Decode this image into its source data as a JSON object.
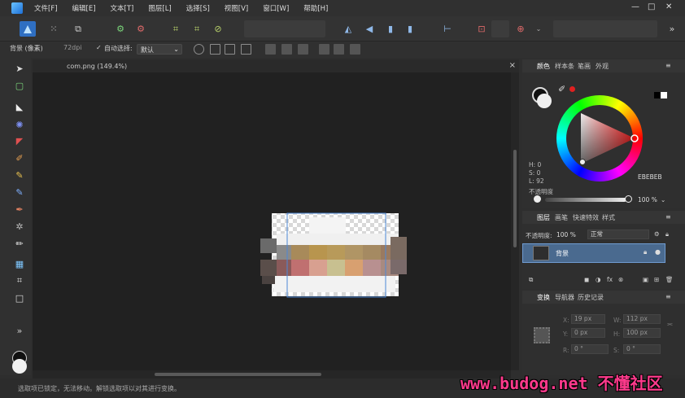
{
  "menu": {
    "items": [
      "文件[F]",
      "编辑[E]",
      "文本[T]",
      "图层[L]",
      "选择[S]",
      "视图[V]",
      "窗口[W]",
      "帮助[H]"
    ],
    "window_controls": [
      "—",
      "□",
      "✕"
    ]
  },
  "context": {
    "layer_label": "背景 (像素)",
    "dpi": "72dpi",
    "auto_select_label": "自动选择:",
    "auto_select_value": "默认"
  },
  "document": {
    "tab_title": "com.png (149.4%)"
  },
  "status": {
    "text": "选取项已锁定，无法移动。解锁选取项以对其进行变换。"
  },
  "color_panel": {
    "tabs": [
      "颜色",
      "样本条",
      "笔画",
      "外观"
    ],
    "h": "H: 0",
    "s": "S: 0",
    "l": "L: 92",
    "hex": "EBEBEB",
    "opacity_label": "不透明度",
    "opacity_value": "100 %"
  },
  "layers_panel": {
    "tabs": [
      "图层",
      "画笔",
      "快速特效",
      "样式"
    ],
    "opacity_label": "不透明度:",
    "opacity_value": "100 %",
    "blend_mode": "正常",
    "layer_name": "背景"
  },
  "transform_panel": {
    "tabs": [
      "变换",
      "导航器",
      "历史记录"
    ],
    "x_label": "X:",
    "x_value": "19 px",
    "y_label": "Y:",
    "y_value": "0 px",
    "w_label": "W:",
    "w_value": "112 px",
    "h_label": "H:",
    "h_value": "100 px",
    "r_label": "R:",
    "r_value": "0 °",
    "s_label": "S:",
    "s_value": "0 °"
  },
  "watermark": {
    "text": "www.budog.net 不懂社区"
  },
  "colors": {
    "accent": "#4c88d6",
    "layer_selected": "#4a6a8f",
    "watermark": "#ff3a8c"
  }
}
